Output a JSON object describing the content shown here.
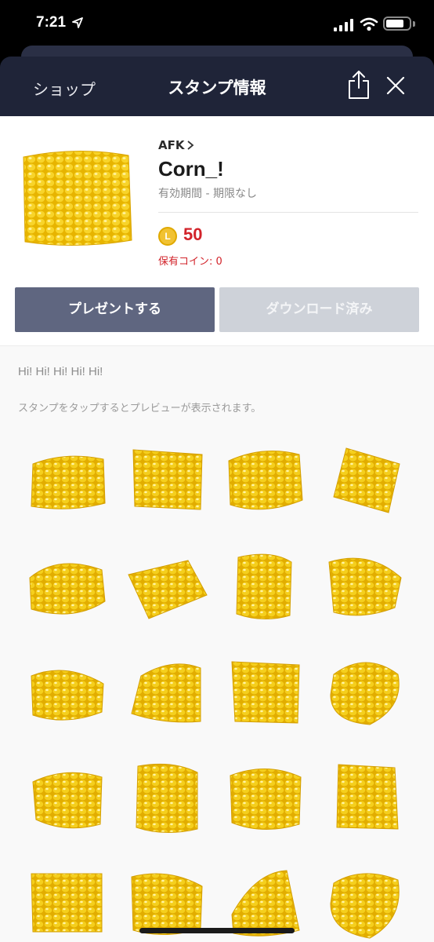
{
  "status_bar": {
    "time": "7:21"
  },
  "header": {
    "back_label": "ショップ",
    "title": "スタンプ情報"
  },
  "product": {
    "author": "AFK",
    "title": "Corn_!",
    "validity": "有効期間 - 期限なし",
    "coin_label": "L",
    "price": "50",
    "owned_coins": "保有コイン: 0"
  },
  "buttons": {
    "present": "プレゼントする",
    "downloaded": "ダウンロード済み"
  },
  "description": "Hi! Hi! Hi! Hi! Hi!",
  "hint": "スタンプをタップするとプレビューが表示されます。",
  "stickers": [
    {
      "id": "corn-sticker-1"
    },
    {
      "id": "corn-sticker-2"
    },
    {
      "id": "corn-sticker-3"
    },
    {
      "id": "corn-sticker-4"
    },
    {
      "id": "corn-sticker-5"
    },
    {
      "id": "corn-sticker-6"
    },
    {
      "id": "corn-sticker-7"
    },
    {
      "id": "corn-sticker-8"
    },
    {
      "id": "corn-sticker-9"
    },
    {
      "id": "corn-sticker-10"
    },
    {
      "id": "corn-sticker-11"
    },
    {
      "id": "corn-sticker-12"
    },
    {
      "id": "corn-sticker-13"
    },
    {
      "id": "corn-sticker-14"
    },
    {
      "id": "corn-sticker-15"
    },
    {
      "id": "corn-sticker-16"
    },
    {
      "id": "corn-sticker-17"
    },
    {
      "id": "corn-sticker-18"
    },
    {
      "id": "corn-sticker-19"
    },
    {
      "id": "corn-sticker-20"
    }
  ],
  "colors": {
    "header_bg": "#1f2438",
    "present_button": "#5f6680",
    "downloaded_button": "#ced2d9",
    "price_red": "#d2232a",
    "coin_gold": "#f1c232",
    "corn_yellow": "#f5cf1d"
  }
}
